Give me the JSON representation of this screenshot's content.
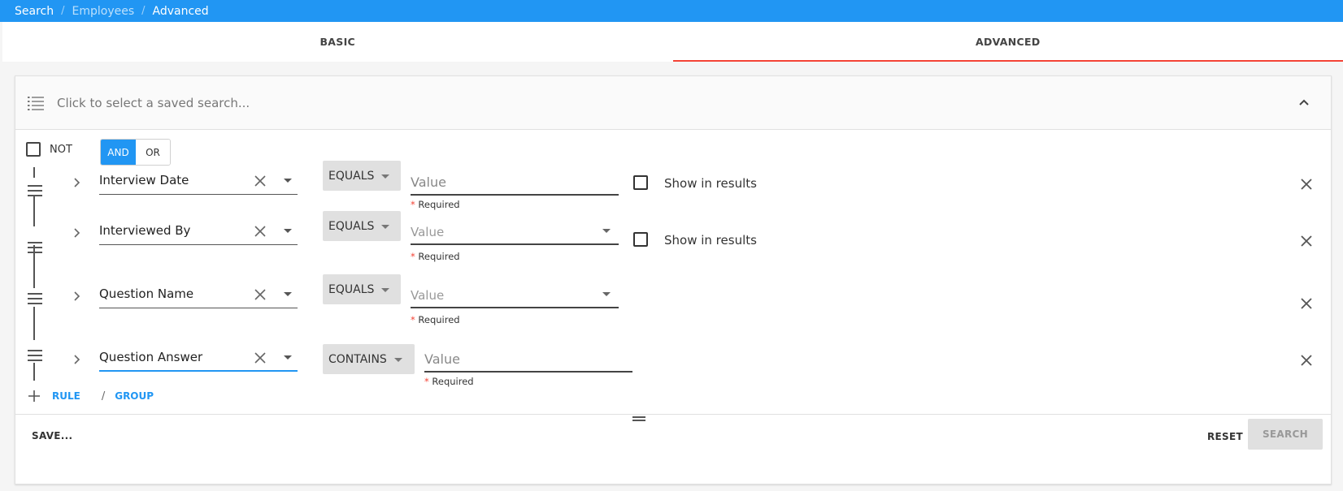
{
  "breadcrumb": [
    "Search",
    "Employees",
    "Advanced"
  ],
  "tabs": [
    {
      "label": "BASIC",
      "active": false
    },
    {
      "label": "ADVANCED",
      "active": true
    }
  ],
  "saved_search": {
    "placeholder": "Click to select a saved search..."
  },
  "group": {
    "not_label": "NOT",
    "and_label": "AND",
    "or_label": "OR",
    "selected": "AND"
  },
  "rules": [
    {
      "field": "Interview Date",
      "operator": "EQUALS",
      "value_placeholder": "Value",
      "value_type": "text",
      "required": "Required",
      "show_in_results": "Show in results"
    },
    {
      "field": "Interviewed By",
      "operator": "EQUALS",
      "value_placeholder": "Value",
      "value_type": "select",
      "required": "Required",
      "show_in_results": "Show in results"
    },
    {
      "field": "Question Name",
      "operator": "EQUALS",
      "value_placeholder": "Value",
      "value_type": "select",
      "required": "Required"
    },
    {
      "field": "Question Answer",
      "operator": "CONTAINS",
      "value_placeholder": "Value",
      "value_type": "text",
      "required": "Required",
      "focused": true
    }
  ],
  "add": {
    "rule_label": "RULE",
    "separator": "/",
    "group_label": "GROUP"
  },
  "footer": {
    "save_label": "SAVE...",
    "reset_label": "RESET",
    "search_label": "SEARCH"
  },
  "colors": {
    "primary": "#2196f3",
    "active_tab_indicator": "#f44336",
    "required_star": "#f44336"
  }
}
